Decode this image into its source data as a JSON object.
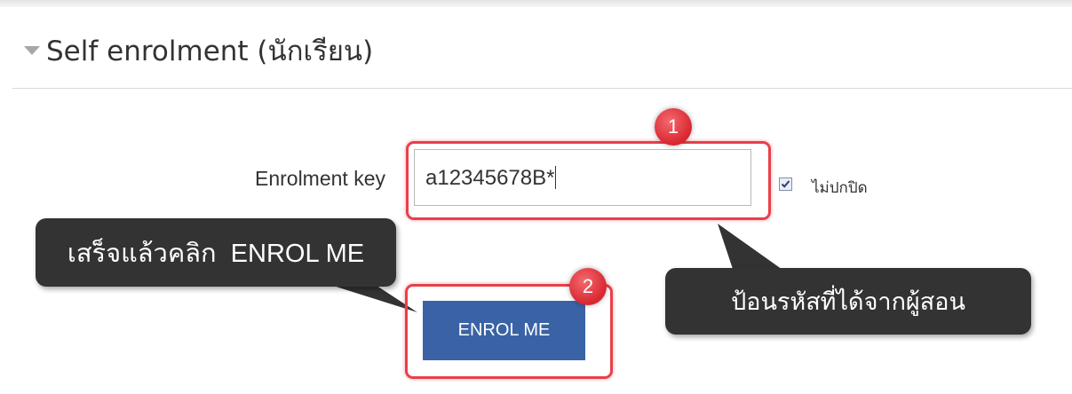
{
  "section": {
    "title": "Self enrolment (นักเรียน)",
    "collapse_icon": "triangle-down-icon"
  },
  "form": {
    "enrolment_key_label": "Enrolment key",
    "enrolment_key_value": "a12345678B*",
    "unmask_checked": true,
    "unmask_label": "ไม่ปกปิด",
    "submit_label": "ENROL ME"
  },
  "annotations": {
    "step1_number": "1",
    "step2_number": "2",
    "callout_left_text": "เสร็จแล้วคลิก  ENROL ME",
    "callout_right_text": "ป้อนรหัสที่ได้จากผู้สอน",
    "highlight_color": "#e8404a",
    "callout_color": "#333333"
  },
  "colors": {
    "button_blue": "#3a63a6"
  }
}
